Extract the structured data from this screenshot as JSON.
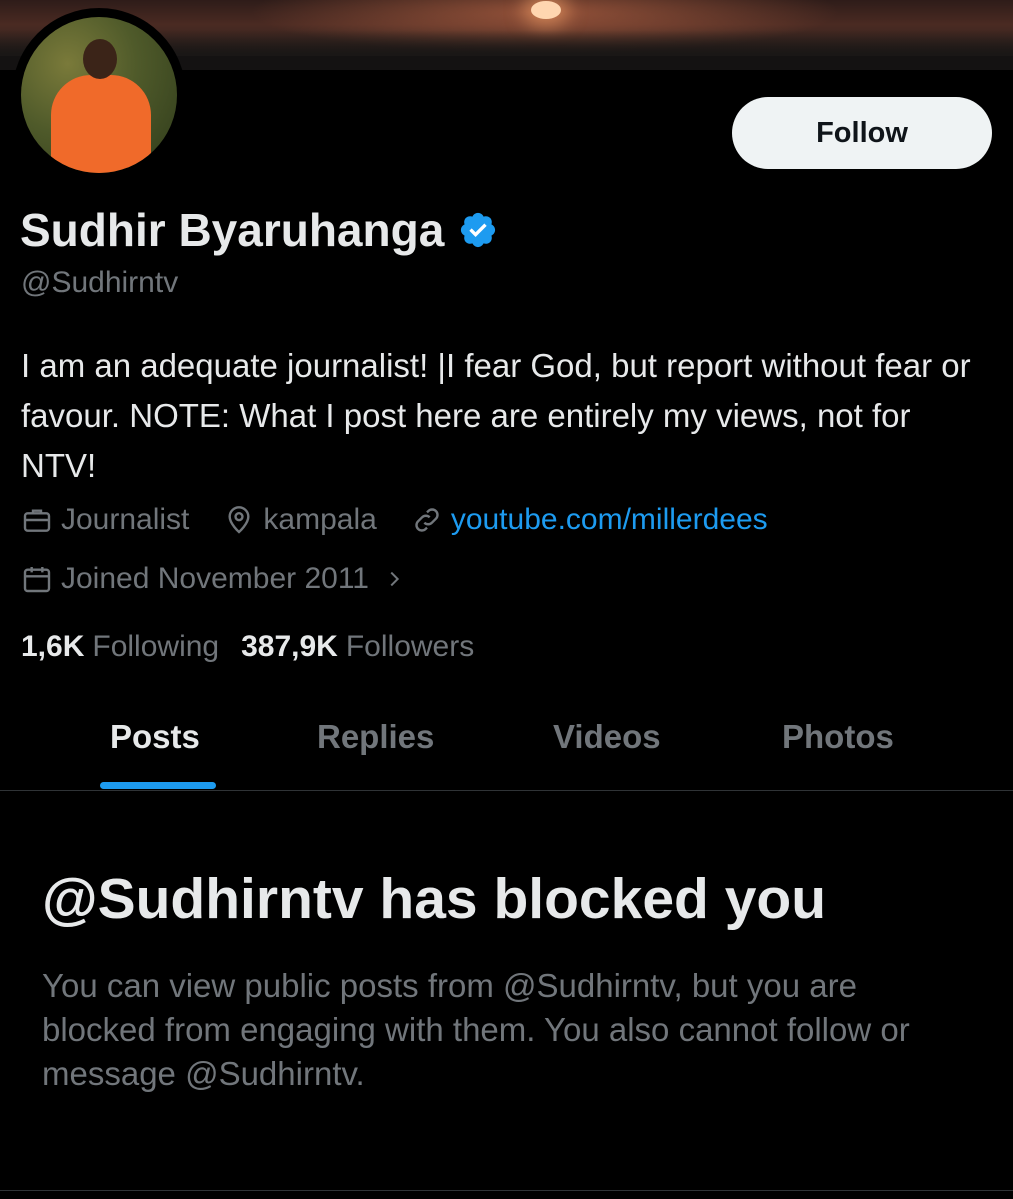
{
  "profile": {
    "display_name": "Sudhir Byaruhanga",
    "handle": "@Sudhirntv",
    "bio": "I am an adequate journalist! |I fear God, but report without fear or favour. NOTE: What I post here are entirely my views, not for NTV!",
    "category": "Journalist",
    "location": "kampala",
    "website": "youtube.com/millerdees",
    "joined": "Joined November 2011",
    "following_count": "1,6K",
    "following_label": "Following",
    "followers_count": "387,9K",
    "followers_label": "Followers"
  },
  "actions": {
    "follow_label": "Follow"
  },
  "tabs": [
    {
      "label": "Posts",
      "active": true
    },
    {
      "label": "Replies",
      "active": false
    },
    {
      "label": "Videos",
      "active": false
    },
    {
      "label": "Photos",
      "active": false
    }
  ],
  "blocked": {
    "title": "@Sudhirntv has blocked you",
    "message": "You can view public posts from @Sudhirntv, but you are blocked from engaging with them. You also cannot follow or message @Sudhirntv."
  },
  "icons": {
    "verified": "verified-badge-icon",
    "category": "briefcase-icon",
    "location": "location-pin-icon",
    "website": "link-icon",
    "joined": "calendar-icon",
    "joined_chevron": "chevron-right-icon"
  },
  "colors": {
    "background": "#000000",
    "text_primary": "#e7e9ea",
    "text_secondary": "#71767b",
    "accent": "#1d9bf0",
    "button_bg": "#eff3f4"
  }
}
